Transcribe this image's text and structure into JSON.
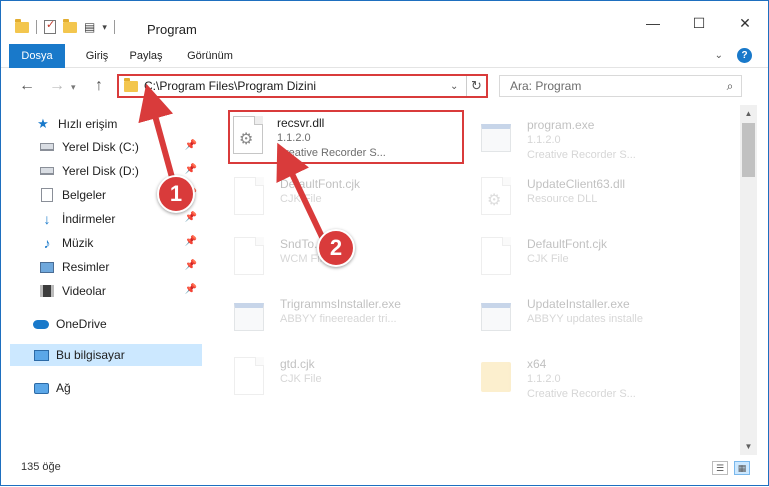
{
  "window": {
    "title": "Program",
    "controls": {
      "minimize": "—",
      "maximize": "☐",
      "close": "✕"
    }
  },
  "ribbon": {
    "tabs": [
      "Dosya",
      "Giriş",
      "Paylaş",
      "Görünüm"
    ],
    "help": "?"
  },
  "nav": {
    "back": "←",
    "forward": "→",
    "up": "↑",
    "address": "C:\\Program Files\\Program Dizini",
    "search_placeholder": "Ara: Program"
  },
  "sidebar": {
    "items": [
      {
        "label": "Hızlı erişim",
        "icon": "star-icon"
      },
      {
        "label": "Yerel Disk (C:)",
        "icon": "drive-icon",
        "pinned": true
      },
      {
        "label": "Yerel Disk (D:)",
        "icon": "drive-icon",
        "pinned": true
      },
      {
        "label": "Belgeler",
        "icon": "documents-icon",
        "pinned": true
      },
      {
        "label": "İndirmeler",
        "icon": "download-icon",
        "pinned": true
      },
      {
        "label": "Müzik",
        "icon": "music-icon",
        "pinned": true
      },
      {
        "label": "Resimler",
        "icon": "pictures-icon",
        "pinned": true
      },
      {
        "label": "Videolar",
        "icon": "videos-icon",
        "pinned": true
      },
      {
        "label": "OneDrive",
        "icon": "onedrive-icon"
      },
      {
        "label": "Bu bilgisayar",
        "icon": "this-pc-icon",
        "selected": true
      },
      {
        "label": "Ağ",
        "icon": "network-icon"
      }
    ]
  },
  "files": [
    {
      "name": "recsvr.dll",
      "line2": "1.1.2.0",
      "line3": "Creative Recorder S...",
      "icon": "dll-file-icon",
      "highlighted": true
    },
    {
      "name": "program.exe",
      "line2": "1.1.2.0",
      "line3": "Creative Recorder S...",
      "icon": "exe-file-icon"
    },
    {
      "name": "DefaultFont.cjk",
      "line2": "CJK File",
      "line3": "",
      "icon": "generic-file-icon"
    },
    {
      "name": "UpdateClient63.dll",
      "line2": "Resource DLL",
      "line3": "",
      "icon": "dll-file-icon"
    },
    {
      "name": "SndTo...wcm",
      "line2": "WCM File",
      "line3": "",
      "icon": "generic-file-icon"
    },
    {
      "name": "DefaultFont.cjk",
      "line2": "CJK File",
      "line3": "",
      "icon": "generic-file-icon"
    },
    {
      "name": "TrigrammsInstaller.exe",
      "line2": "ABBYY fineereader tri...",
      "line3": "",
      "icon": "exe-file-icon"
    },
    {
      "name": "UpdateInstaller.exe",
      "line2": "ABBYY updates installe",
      "line3": "",
      "icon": "exe-file-icon"
    },
    {
      "name": "gtd.cjk",
      "line2": "CJK File",
      "line3": "",
      "icon": "generic-file-icon"
    },
    {
      "name": "x64",
      "line2": "1.1.2.0",
      "line3": "Creative Recorder S...",
      "icon": "folder-icon"
    }
  ],
  "status": {
    "item_count": "135 öğe"
  },
  "annotations": {
    "step1": "1",
    "step2": "2",
    "color": "#d93b3b"
  }
}
